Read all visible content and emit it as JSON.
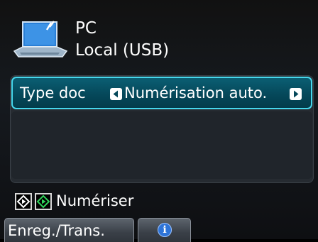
{
  "destination": {
    "label": "PC",
    "connection": "Local (USB)",
    "icon": "laptop-icon"
  },
  "settings": [
    {
      "label": "Type doc",
      "value": "Numérisation auto."
    }
  ],
  "scan": {
    "label": "Numériser",
    "bw_icon": "black-start-icon",
    "color_icon": "color-start-icon"
  },
  "softkeys": {
    "left_label": "Enreg./Trans.",
    "right_icon": "info-icon",
    "right_glyph": "i"
  },
  "colors": {
    "highlight_border": "#46d7ec",
    "highlight_fill": "#05485a",
    "color_start_green": "#2fd35a",
    "info_blue": "#2e74d8"
  }
}
